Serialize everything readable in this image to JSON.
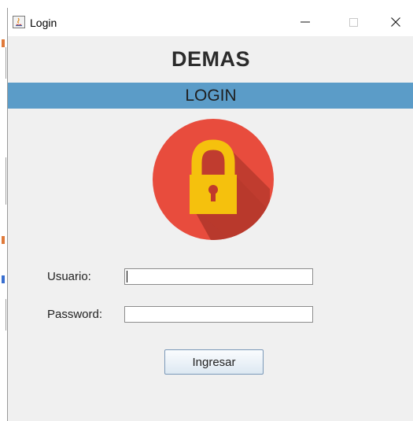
{
  "window": {
    "title": "Login",
    "controls": {
      "minimize_icon": "minimize-icon",
      "maximize_icon": "maximize-icon",
      "close_icon": "close-icon"
    }
  },
  "app": {
    "heading": "DEMAS",
    "banner": "LOGIN"
  },
  "logo": {
    "icon": "padlock-icon",
    "circle_color": "#e84c3d",
    "shadow_color": "#b8392d",
    "lock_color": "#f5c10d"
  },
  "form": {
    "username_label": "Usuario:",
    "username_value": "",
    "password_label": "Password:",
    "password_value": "",
    "submit_label": "Ingresar"
  },
  "colors": {
    "banner": "#5b9cc8",
    "window_bg": "#f0f0f0"
  }
}
